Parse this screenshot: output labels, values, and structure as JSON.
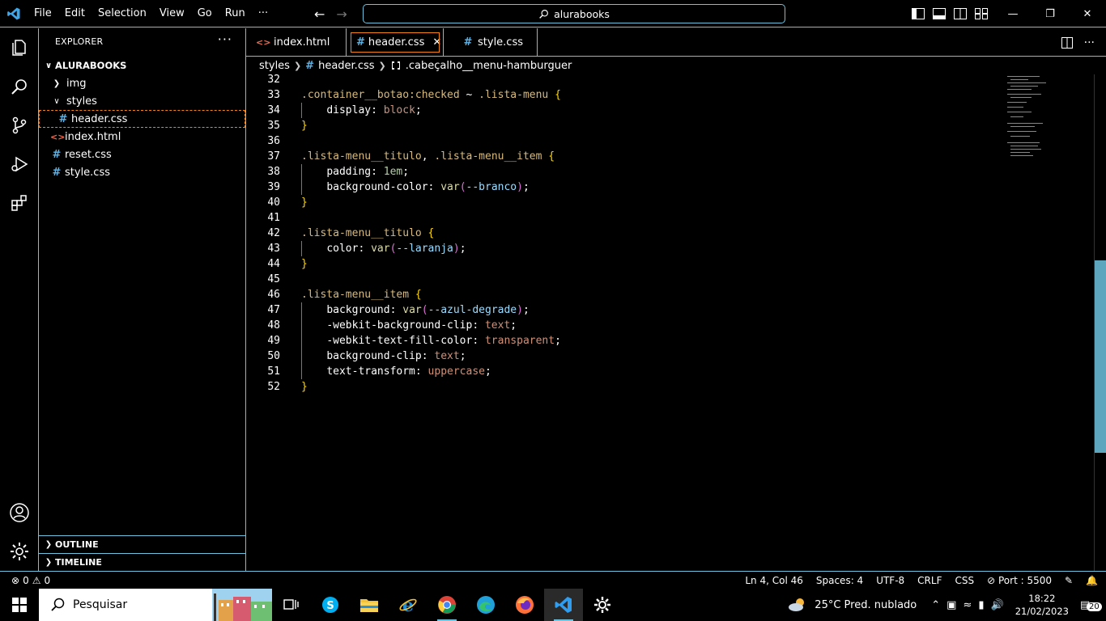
{
  "titlebar": {
    "menu": [
      "File",
      "Edit",
      "Selection",
      "View",
      "Go",
      "Run",
      "···"
    ],
    "search": "alurabooks"
  },
  "sidebar": {
    "title": "EXPLORER",
    "more": "···",
    "root": "ALURABOOKS",
    "items": [
      {
        "label": "img",
        "type": "folder",
        "expanded": false
      },
      {
        "label": "styles",
        "type": "folder",
        "expanded": true
      },
      {
        "label": "header.css",
        "type": "css",
        "selected": true
      },
      {
        "label": "index.html",
        "type": "html"
      },
      {
        "label": "reset.css",
        "type": "css"
      },
      {
        "label": "style.css",
        "type": "css"
      }
    ],
    "outline": "OUTLINE",
    "timeline": "TIMELINE"
  },
  "tabs": [
    {
      "label": "index.html",
      "icon": "html"
    },
    {
      "label": "header.css",
      "icon": "css",
      "active": true
    },
    {
      "label": "style.css",
      "icon": "css"
    }
  ],
  "breadcrumb": [
    "styles",
    "header.css",
    ".cabeçalho__menu-hamburguer"
  ],
  "code_lines": [
    {
      "n": "32",
      "text": ""
    },
    {
      "n": "33",
      "text": ".container__botao:checked ~ .lista-menu {"
    },
    {
      "n": "34",
      "text": "    display: block;"
    },
    {
      "n": "35",
      "text": "}"
    },
    {
      "n": "36",
      "text": ""
    },
    {
      "n": "37",
      "text": ".lista-menu__titulo, .lista-menu__item {"
    },
    {
      "n": "38",
      "text": "    padding: 1em;"
    },
    {
      "n": "39",
      "text": "    background-color: var(--branco);"
    },
    {
      "n": "40",
      "text": "}"
    },
    {
      "n": "41",
      "text": ""
    },
    {
      "n": "42",
      "text": ".lista-menu__titulo {"
    },
    {
      "n": "43",
      "text": "    color: var(--laranja);"
    },
    {
      "n": "44",
      "text": "}"
    },
    {
      "n": "45",
      "text": ""
    },
    {
      "n": "46",
      "text": ".lista-menu__item {"
    },
    {
      "n": "47",
      "text": "    background: var(--azul-degrade);"
    },
    {
      "n": "48",
      "text": "    -webkit-background-clip: text;"
    },
    {
      "n": "49",
      "text": "    -webkit-text-fill-color: transparent;"
    },
    {
      "n": "50",
      "text": "    background-clip: text;"
    },
    {
      "n": "51",
      "text": "    text-transform: uppercase;"
    },
    {
      "n": "52",
      "text": "}"
    }
  ],
  "statusbar": {
    "errors": "0",
    "warnings": "0",
    "position": "Ln 4, Col 46",
    "spaces": "Spaces: 4",
    "encoding": "UTF-8",
    "eol": "CRLF",
    "language": "CSS",
    "port": "Port : 5500"
  },
  "taskbar": {
    "search_placeholder": "Pesquisar",
    "weather": "25°C  Pred. nublado",
    "time": "18:22",
    "date": "21/02/2023",
    "notifications": "20"
  },
  "colors": {
    "accent_border": "#6fc3df",
    "active_outline": "#f38518",
    "selector": "#d7ba7d",
    "value": "#ce9178"
  }
}
